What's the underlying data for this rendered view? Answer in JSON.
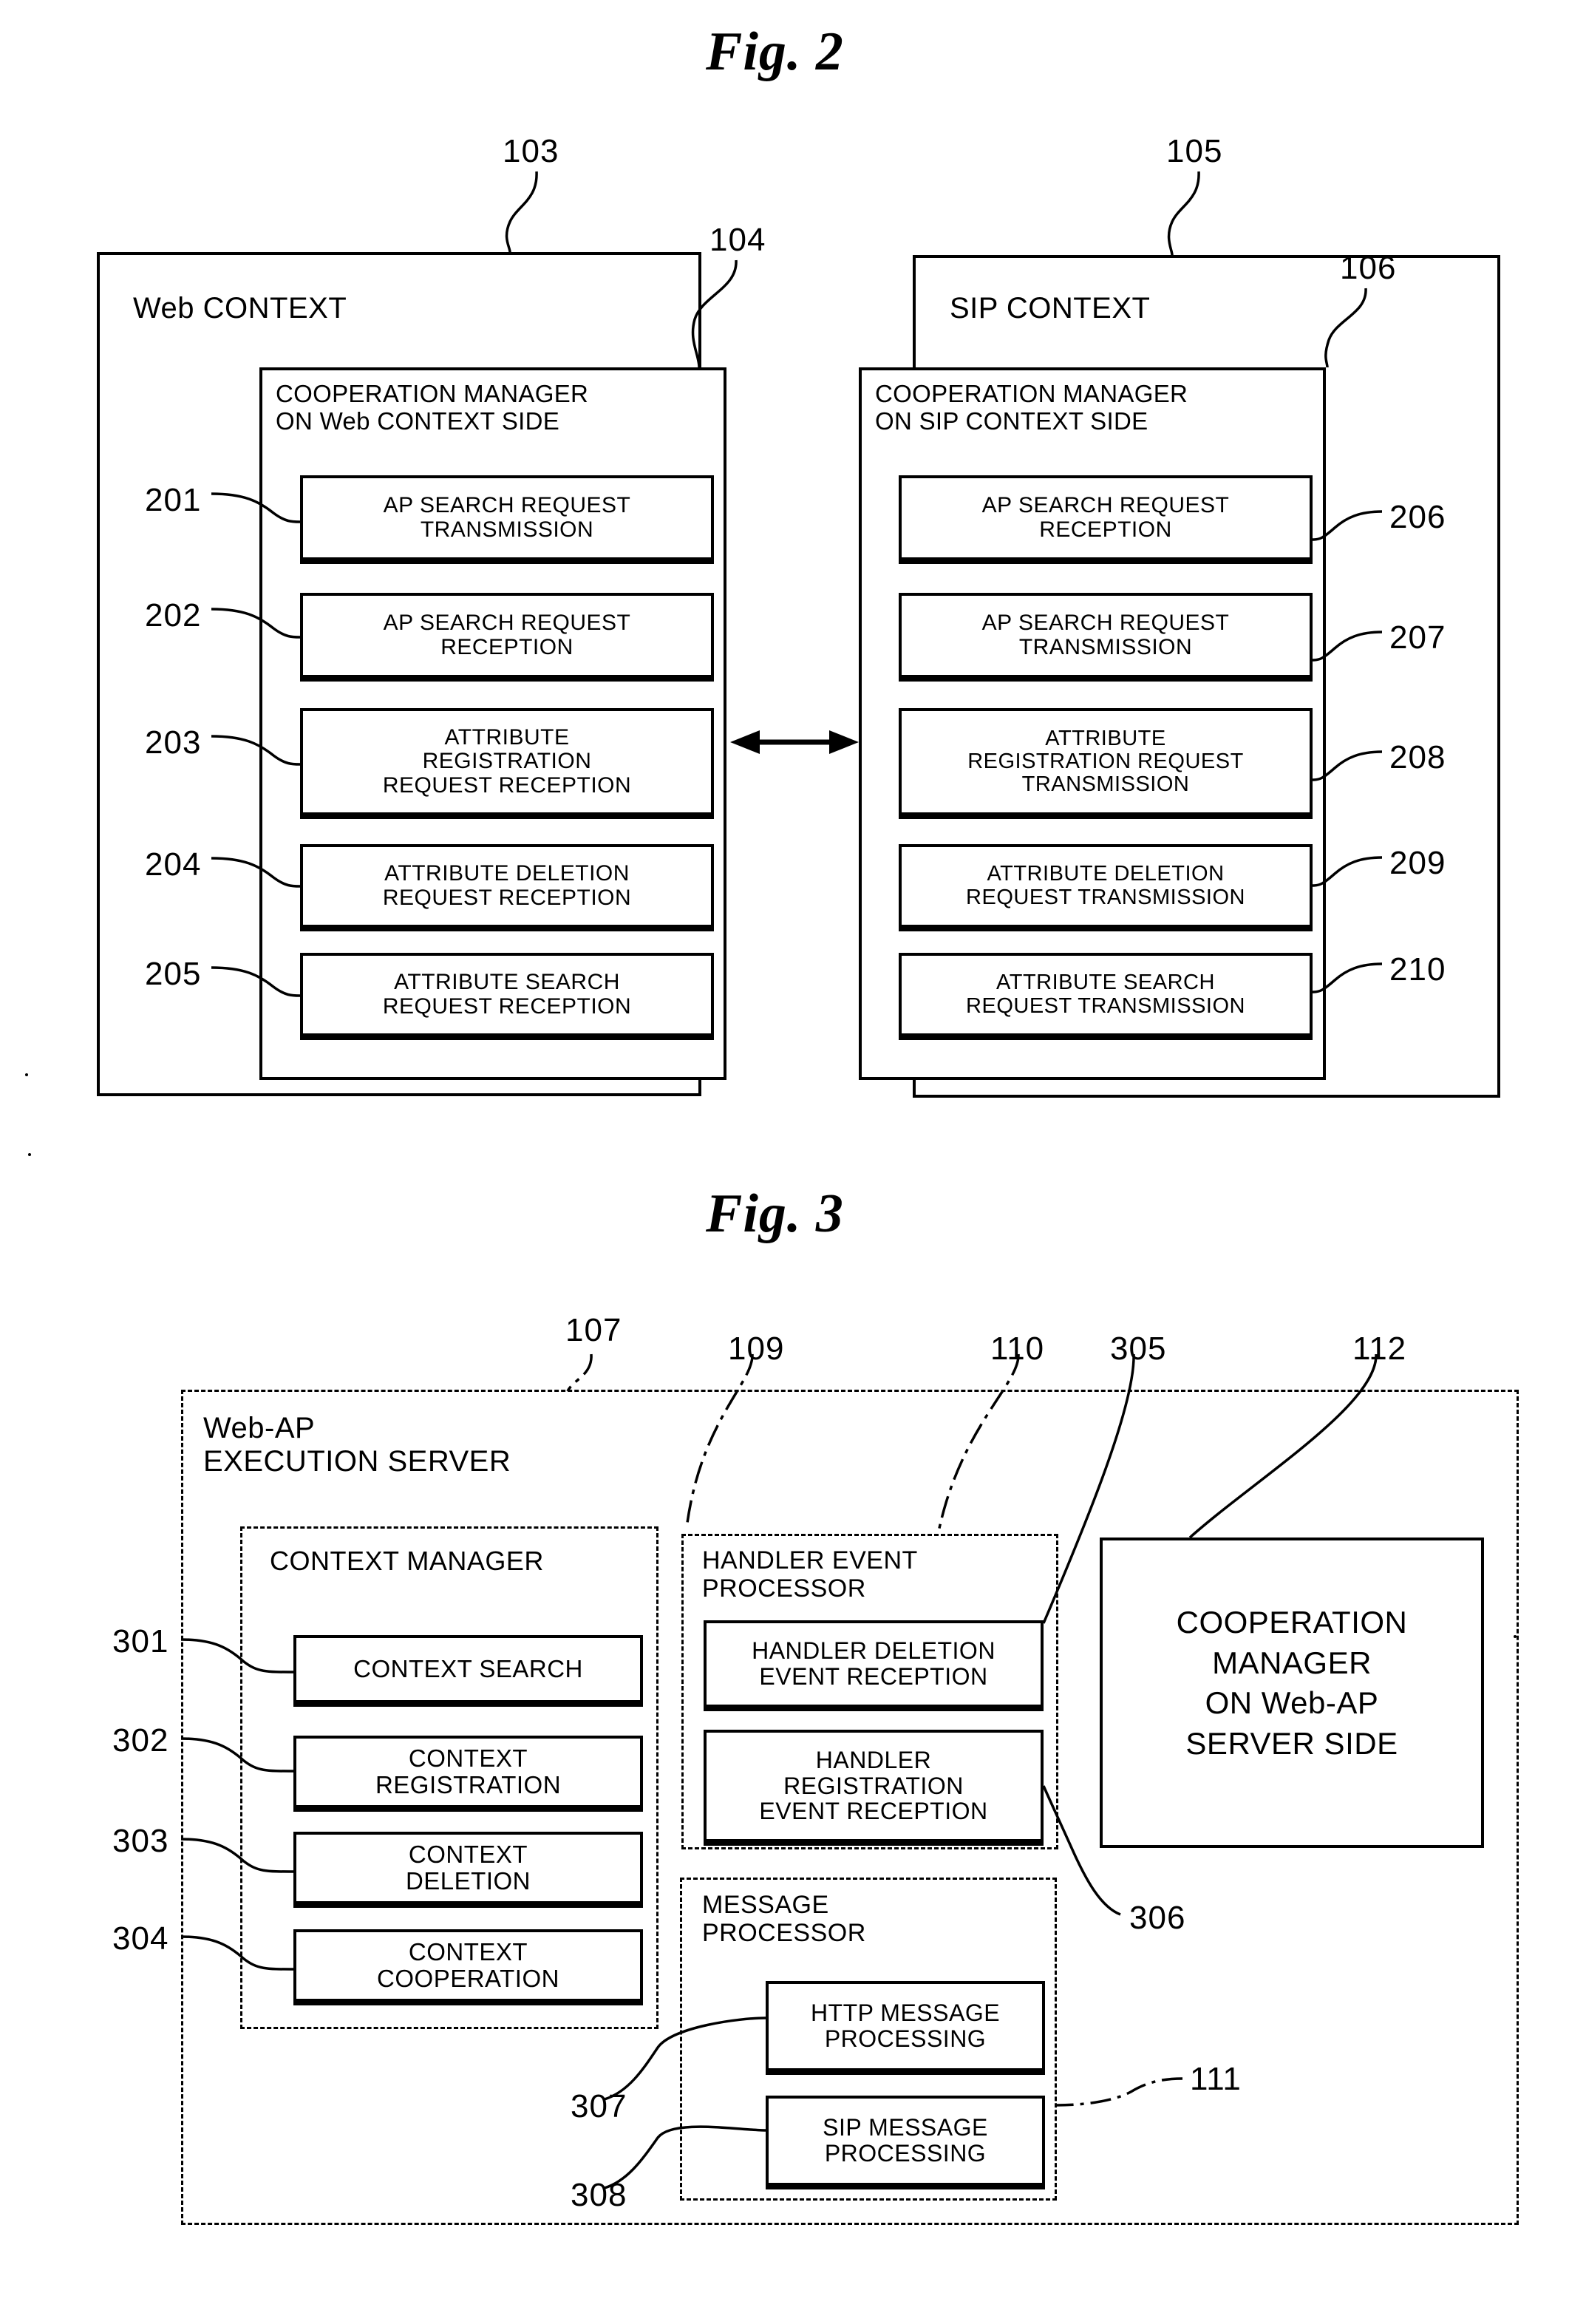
{
  "figures": [
    {
      "title": "Fig. 2",
      "contexts": [
        {
          "ref": "103",
          "name": "Web CONTEXT",
          "manager": {
            "ref": "104",
            "title_line1": "COOPERATION MANAGER",
            "title_line2": "ON Web CONTEXT SIDE",
            "items": [
              {
                "ref": "201",
                "label": "AP SEARCH REQUEST\nTRANSMISSION"
              },
              {
                "ref": "202",
                "label": "AP SEARCH REQUEST\nRECEPTION"
              },
              {
                "ref": "203",
                "label": "ATTRIBUTE\nREGISTRATION\nREQUEST RECEPTION"
              },
              {
                "ref": "204",
                "label": "ATTRIBUTE DELETION\nREQUEST RECEPTION"
              },
              {
                "ref": "205",
                "label": "ATTRIBUTE SEARCH\nREQUEST RECEPTION"
              }
            ]
          }
        },
        {
          "ref": "105",
          "name": "SIP CONTEXT",
          "manager": {
            "ref": "106",
            "title_line1": "COOPERATION MANAGER",
            "title_line2": "ON SIP CONTEXT SIDE",
            "items": [
              {
                "ref": "206",
                "label": "AP SEARCH REQUEST\nRECEPTION"
              },
              {
                "ref": "207",
                "label": "AP SEARCH REQUEST\nTRANSMISSION"
              },
              {
                "ref": "208",
                "label": "ATTRIBUTE\nREGISTRATION REQUEST\nTRANSMISSION"
              },
              {
                "ref": "209",
                "label": "ATTRIBUTE DELETION\nREQUEST TRANSMISSION"
              },
              {
                "ref": "210",
                "label": "ATTRIBUTE SEARCH\nREQUEST TRANSMISSION"
              }
            ]
          }
        }
      ],
      "connector": "bidirectional-arrow"
    },
    {
      "title": "Fig. 3",
      "server": {
        "ref": "107",
        "name_line1": "Web-AP",
        "name_line2": "EXECUTION SERVER"
      },
      "groups": [
        {
          "ref": "109",
          "title": "CONTEXT MANAGER",
          "items": [
            {
              "ref": "301",
              "label": "CONTEXT SEARCH"
            },
            {
              "ref": "302",
              "label": "CONTEXT\nREGISTRATION"
            },
            {
              "ref": "303",
              "label": "CONTEXT\nDELETION"
            },
            {
              "ref": "304",
              "label": "CONTEXT\nCOOPERATION"
            }
          ]
        },
        {
          "ref": "110",
          "title": "HANDLER EVENT\nPROCESSOR",
          "items": [
            {
              "ref": "305",
              "label": "HANDLER DELETION\nEVENT RECEPTION"
            },
            {
              "ref": "306",
              "label": "HANDLER\nREGISTRATION\nEVENT RECEPTION"
            }
          ]
        },
        {
          "ref": "111",
          "title": "MESSAGE\nPROCESSOR",
          "items": [
            {
              "ref": "307",
              "label": "HTTP MESSAGE\nPROCESSING"
            },
            {
              "ref": "308",
              "label": "SIP MESSAGE\nPROCESSING"
            }
          ]
        }
      ],
      "cooperation_manager": {
        "ref": "112",
        "label": "COOPERATION\nMANAGER\nON Web-AP\nSERVER SIDE"
      }
    }
  ]
}
